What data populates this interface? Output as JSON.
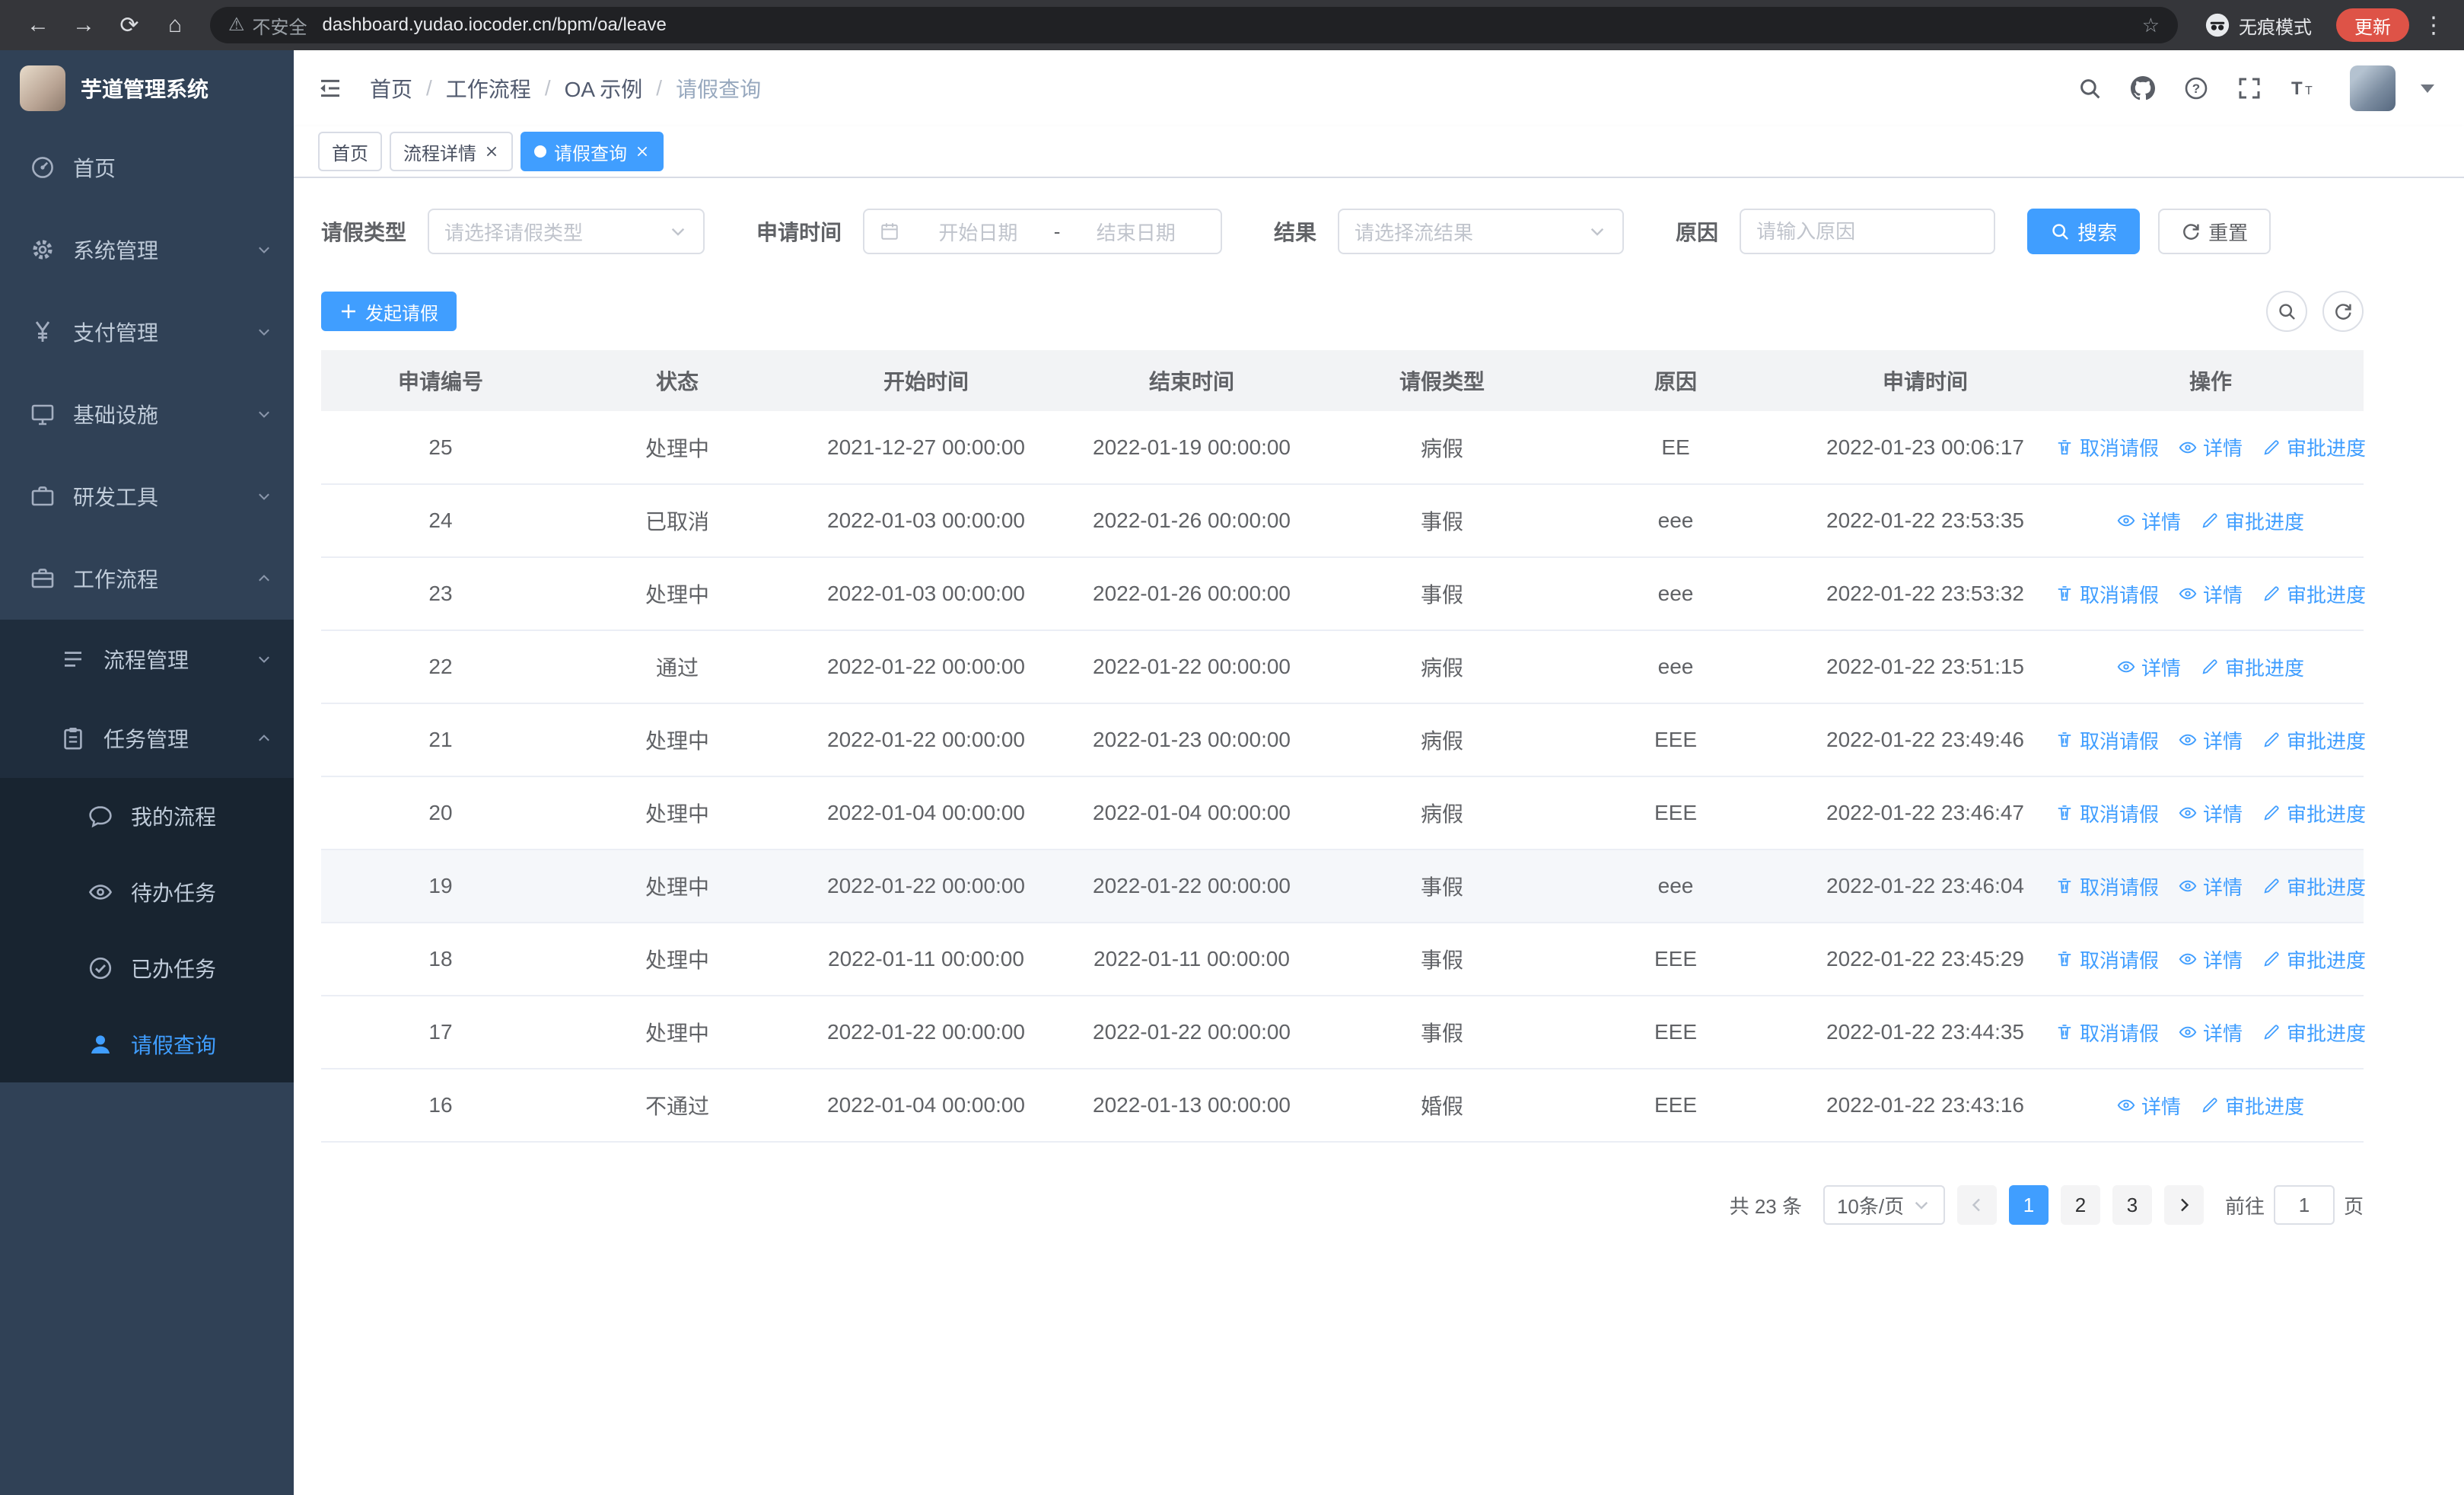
{
  "browser": {
    "security_warning": "不安全",
    "url": "dashboard.yudao.iocoder.cn/bpm/oa/leave",
    "incognito_label": "无痕模式",
    "update_button": "更新"
  },
  "colors": {
    "primary": "#409eff",
    "sidebar_bg": "#304156",
    "submenu_bg": "#1f2d3d",
    "active_tab_bg": "#409eff",
    "update_pill": "#de5347"
  },
  "sidebar": {
    "logo_title": "芋道管理系统",
    "menu": [
      {
        "id": "home",
        "label": "首页",
        "icon": "dashboard"
      },
      {
        "id": "system",
        "label": "系统管理",
        "icon": "gear",
        "arrow": "down"
      },
      {
        "id": "payment",
        "label": "支付管理",
        "icon": "yen",
        "arrow": "down"
      },
      {
        "id": "infra",
        "label": "基础设施",
        "icon": "monitor",
        "arrow": "down"
      },
      {
        "id": "devtools",
        "label": "研发工具",
        "icon": "briefcase",
        "arrow": "down"
      },
      {
        "id": "workflow",
        "label": "工作流程",
        "icon": "suitcase",
        "arrow": "up",
        "children": [
          {
            "id": "process-mgmt",
            "label": "流程管理",
            "icon": "list",
            "arrow": "down"
          },
          {
            "id": "task-mgmt",
            "label": "任务管理",
            "icon": "clipboard",
            "arrow": "up",
            "children": [
              {
                "id": "my-process",
                "label": "我的流程",
                "icon": "chat"
              },
              {
                "id": "todo-tasks",
                "label": "待办任务",
                "icon": "eye"
              },
              {
                "id": "done-tasks",
                "label": "已办任务",
                "icon": "check-circle"
              },
              {
                "id": "leave-query",
                "label": "请假查询",
                "icon": "user",
                "active": true
              }
            ]
          }
        ]
      }
    ]
  },
  "header": {
    "breadcrumb": [
      "首页",
      "工作流程",
      "OA 示例",
      "请假查询"
    ]
  },
  "tabs": [
    {
      "id": "home",
      "label": "首页",
      "closable": false,
      "active": false
    },
    {
      "id": "process-detail",
      "label": "流程详情",
      "closable": true,
      "active": false
    },
    {
      "id": "leave-query",
      "label": "请假查询",
      "closable": true,
      "active": true
    }
  ],
  "filters": {
    "leave_type_label": "请假类型",
    "leave_type_placeholder": "请选择请假类型",
    "apply_time_label": "申请时间",
    "date_start_placeholder": "开始日期",
    "date_separator": "-",
    "date_end_placeholder": "结束日期",
    "result_label": "结果",
    "result_placeholder": "请选择流结果",
    "reason_label": "原因",
    "reason_placeholder": "请输入原因",
    "search_button": "搜索",
    "reset_button": "重置"
  },
  "toolbar": {
    "create_button": "发起请假"
  },
  "table": {
    "columns": [
      "申请编号",
      "状态",
      "开始时间",
      "结束时间",
      "请假类型",
      "原因",
      "申请时间",
      "操作"
    ],
    "actions": {
      "cancel_label": "取消请假",
      "cancel_icon": "trash",
      "detail_label": "详情",
      "detail_icon": "eye",
      "progress_label": "审批进度",
      "progress_icon": "edit"
    },
    "rows": [
      {
        "id": "25",
        "status": "处理中",
        "start": "2021-12-27 00:00:00",
        "end": "2022-01-19 00:00:00",
        "type": "病假",
        "reason": "EE",
        "applied": "2022-01-23 00:06:17",
        "cancelable": true
      },
      {
        "id": "24",
        "status": "已取消",
        "start": "2022-01-03 00:00:00",
        "end": "2022-01-26 00:00:00",
        "type": "事假",
        "reason": "eee",
        "applied": "2022-01-22 23:53:35",
        "cancelable": false
      },
      {
        "id": "23",
        "status": "处理中",
        "start": "2022-01-03 00:00:00",
        "end": "2022-01-26 00:00:00",
        "type": "事假",
        "reason": "eee",
        "applied": "2022-01-22 23:53:32",
        "cancelable": true
      },
      {
        "id": "22",
        "status": "通过",
        "start": "2022-01-22 00:00:00",
        "end": "2022-01-22 00:00:00",
        "type": "病假",
        "reason": "eee",
        "applied": "2022-01-22 23:51:15",
        "cancelable": false
      },
      {
        "id": "21",
        "status": "处理中",
        "start": "2022-01-22 00:00:00",
        "end": "2022-01-23 00:00:00",
        "type": "病假",
        "reason": "EEE",
        "applied": "2022-01-22 23:49:46",
        "cancelable": true
      },
      {
        "id": "20",
        "status": "处理中",
        "start": "2022-01-04 00:00:00",
        "end": "2022-01-04 00:00:00",
        "type": "病假",
        "reason": "EEE",
        "applied": "2022-01-22 23:46:47",
        "cancelable": true
      },
      {
        "id": "19",
        "status": "处理中",
        "start": "2022-01-22 00:00:00",
        "end": "2022-01-22 00:00:00",
        "type": "事假",
        "reason": "eee",
        "applied": "2022-01-22 23:46:04",
        "cancelable": true,
        "highlighted": true
      },
      {
        "id": "18",
        "status": "处理中",
        "start": "2022-01-11 00:00:00",
        "end": "2022-01-11 00:00:00",
        "type": "事假",
        "reason": "EEE",
        "applied": "2022-01-22 23:45:29",
        "cancelable": true
      },
      {
        "id": "17",
        "status": "处理中",
        "start": "2022-01-22 00:00:00",
        "end": "2022-01-22 00:00:00",
        "type": "事假",
        "reason": "EEE",
        "applied": "2022-01-22 23:44:35",
        "cancelable": true
      },
      {
        "id": "16",
        "status": "不通过",
        "start": "2022-01-04 00:00:00",
        "end": "2022-01-13 00:00:00",
        "type": "婚假",
        "reason": "EEE",
        "applied": "2022-01-22 23:43:16",
        "cancelable": false
      }
    ]
  },
  "pagination": {
    "total_text": "共 23 条",
    "page_size": "10条/页",
    "pages": [
      "1",
      "2",
      "3"
    ],
    "active_page": "1",
    "goto_label": "前往",
    "goto_value": "1",
    "goto_suffix": "页"
  }
}
